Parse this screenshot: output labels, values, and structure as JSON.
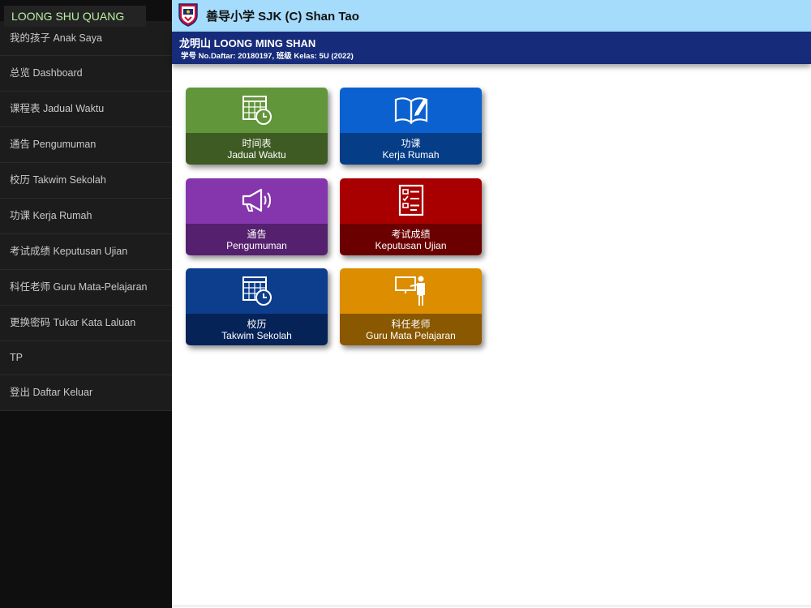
{
  "user": {
    "name": "LOONG SHU QUANG"
  },
  "sidebar": {
    "items": [
      {
        "label": "我的孩子 Anak Saya"
      },
      {
        "label": "总览 Dashboard"
      },
      {
        "label": "课程表 Jadual Waktu"
      },
      {
        "label": "通告 Pengumuman"
      },
      {
        "label": "校历 Takwim Sekolah"
      },
      {
        "label": "功课 Kerja Rumah"
      },
      {
        "label": "考试成绩 Keputusan Ujian"
      },
      {
        "label": "科任老师 Guru Mata-Pelajaran"
      },
      {
        "label": "更换密码 Tukar Kata Laluan"
      },
      {
        "label": "TP"
      },
      {
        "label": "登出 Daftar Keluar"
      }
    ]
  },
  "header": {
    "school_name": "善导小学 SJK (C) Shan Tao"
  },
  "student": {
    "name": "龙明山 LOONG MING SHAN",
    "info": "学号 No.Daftar: 20180197, 班级 Kelas: 5U (2022)"
  },
  "tiles": [
    {
      "line1": "时间表",
      "line2": "Jadual Waktu",
      "icon": "calendar-clock-icon",
      "top_color": "#62963a",
      "bottom_color": "#3e5b23"
    },
    {
      "line1": "功课",
      "line2": "Kerja Rumah",
      "icon": "book-pencil-icon",
      "top_color": "#0b61cf",
      "bottom_color": "#063d87"
    },
    {
      "line1": "通告",
      "line2": "Pengumuman",
      "icon": "megaphone-icon",
      "top_color": "#8536ad",
      "bottom_color": "#55206e"
    },
    {
      "line1": "考试成绩",
      "line2": "Keputusan Ujian",
      "icon": "checklist-icon",
      "top_color": "#a80000",
      "bottom_color": "#6a0000"
    },
    {
      "line1": "校历",
      "line2": "Takwim Sekolah",
      "icon": "calendar-clock-icon",
      "top_color": "#0c3e8d",
      "bottom_color": "#062358"
    },
    {
      "line1": "科任老师",
      "line2": "Guru Mata Pelajaran",
      "icon": "teacher-board-icon",
      "top_color": "#dc8d00",
      "bottom_color": "#895800"
    }
  ],
  "colors": {
    "sidebar_bg": "#0f0f0f",
    "sidebar_item_bg": "#1c1c1c",
    "user_name_text": "#b7f0a4",
    "topbar_bg": "#a5dbfb",
    "student_bar_bg": "#162b7a"
  }
}
